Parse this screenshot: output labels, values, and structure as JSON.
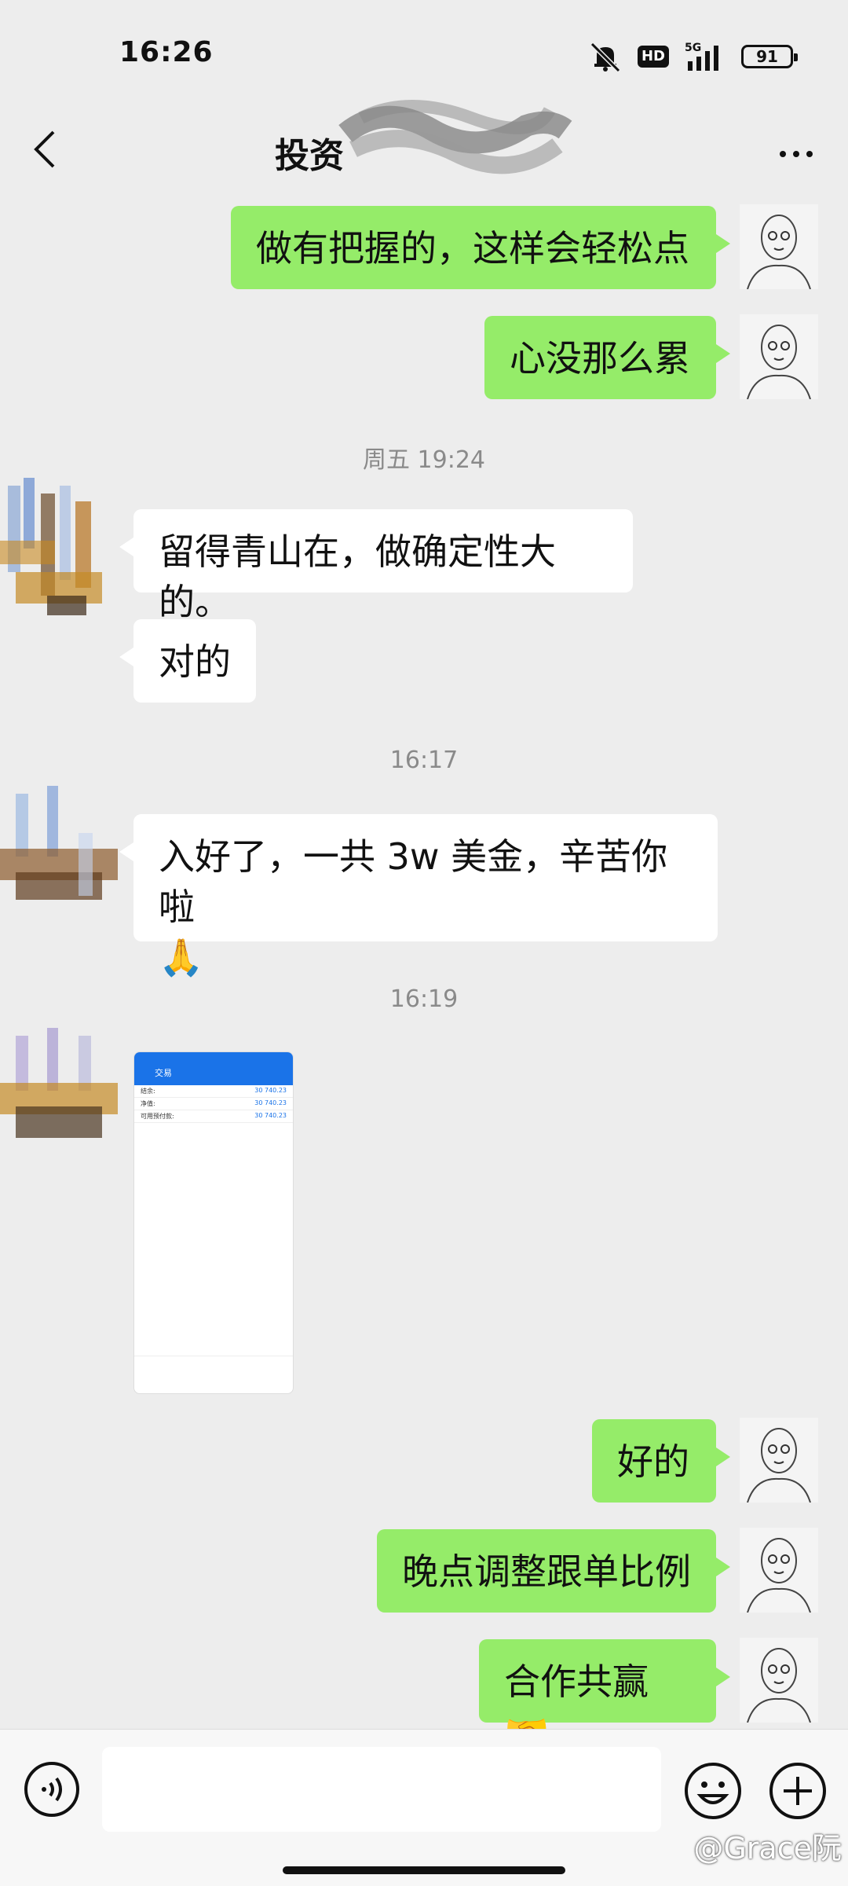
{
  "status_bar": {
    "time": "16:26",
    "network": "5G",
    "hd": "HD",
    "battery": "91"
  },
  "header": {
    "title": "投资"
  },
  "messages": {
    "m1": "做有把握的，这样会轻松点",
    "m2": "心没那么累",
    "ts1": "周五 19:24",
    "m3": "留得青山在，做确定性大的。",
    "m4": "对的",
    "ts2": "16:17",
    "m5_line1": "入好了，一共 3w 美金，辛苦你啦",
    "m5_emoji": "🙏",
    "ts3": "16:19",
    "image": {
      "title": "交易",
      "rows": [
        {
          "label": "结余:",
          "value": "30 740.23"
        },
        {
          "label": "净值:",
          "value": "30 740.23"
        },
        {
          "label": "可用预付款:",
          "value": "30 740.23"
        }
      ]
    },
    "m6": "好的",
    "m7": "晚点调整跟单比例",
    "m8": "合作共赢🤝"
  },
  "input": {
    "placeholder": ""
  },
  "watermark": "@Grace阮",
  "colors": {
    "outgoing_bubble": "#95ec69",
    "incoming_bubble": "#ffffff",
    "background": "#ededed"
  }
}
